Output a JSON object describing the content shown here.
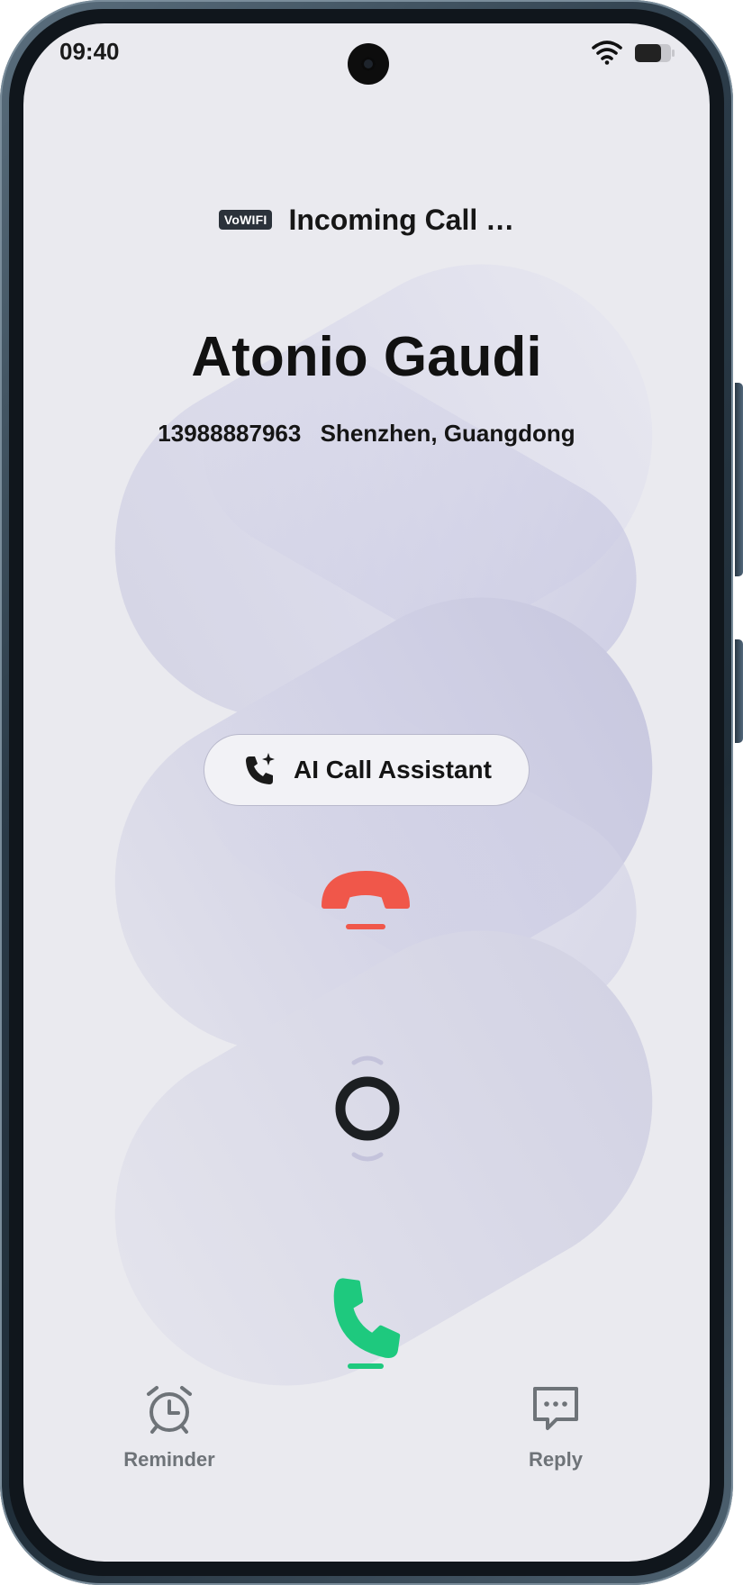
{
  "status_bar": {
    "time": "09:40",
    "wifi_icon": "wifi-icon",
    "battery_icon": "battery-icon"
  },
  "call": {
    "network_badge": "VoWIFI",
    "status_text": "Incoming Call …",
    "caller_name": "Atonio Gaudi",
    "caller_number": "13988887963",
    "caller_location": "Shenzhen, Guangdong"
  },
  "ai_assistant": {
    "label": "AI Call Assistant",
    "icon": "ai-phone-sparkle-icon"
  },
  "controls": {
    "decline_icon": "decline-call-icon",
    "slider_icon": "slider-knob-icon",
    "answer_icon": "answer-call-icon",
    "decline_color": "#f0574a",
    "answer_color": "#1ec97e"
  },
  "actions": {
    "reminder_label": "Reminder",
    "reply_label": "Reply"
  },
  "colors": {
    "screen_background": "#eaeaef",
    "text_primary": "#111111",
    "action_label": "#6e7378",
    "ribbon_tint": "#c9c9e0"
  }
}
